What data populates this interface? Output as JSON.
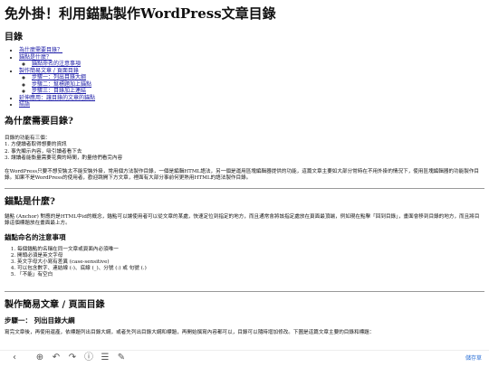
{
  "title": "免外掛！利用錨點製作WordPress文章目錄",
  "toc": {
    "heading": "目錄",
    "items": [
      {
        "label": "為什麼需要目錄？"
      },
      {
        "label": "錨點是什麼？"
      },
      {
        "label": "錨點命名的注意事項"
      },
      {
        "label": "製作簡易文章 / 頁面目錄"
      },
      {
        "label": "步驟一：列出目錄大綱"
      },
      {
        "label": "步驟二：幫標題加上錨點"
      },
      {
        "label": "步驟三：目錄加上連結"
      },
      {
        "label": "延伸應用：讓目錄的文章的錨點"
      },
      {
        "label": "結語"
      }
    ]
  },
  "sections": {
    "why": {
      "heading": "為什麼需要目錄?",
      "intro": "目錄的功能有三個：",
      "lines": [
        "1. 方便讀者取得想要的資訊",
        "2. 事先顯示內容，吸引讀者看下去",
        "3. 讓讀者能衡量需要花費的時間，酌量他們看完內容"
      ],
      "paragraph": "在WordPress只要不想安裝太不能安裝外掛，常用個方法製作目錄，一個是編輯HTML語法，另一個是運用區塊編輯器提供的功能，這篇文章主要如大部分常時在不用外掛的情況下，使用區塊編輯器的功能製作目錄。如果不是WordPress的使用者，歡迎跳開下方文章，裡面有大部分事前何更熟用HTML的語法製作目錄。"
    },
    "anchor": {
      "heading": "錨點是什麼?",
      "paragraph": "錨點 (Anchor) 對應的是HTML中id的概念，錨點可以讓使用者可以從文章的某處，快速定位到指定的地方，而且通常會將該指定處放在頁面最頂端，例如現在點擊「回到目錄」，畫面會移到目錄的地方，而且將目錄這個標題放在畫面最上方。",
      "sub_heading": "錨點命名的注意事項",
      "rules": [
        "每個錨點的名稱在同一文章或頁面內必須唯一",
        "開頭必須是英文字母",
        "英文字母大小寫有差異 (case-sensitive)",
        "可以包含數字、連結線 (-)、底線 (_)、分號 (:) 或 句號 (.)",
        "「不能」有空白"
      ]
    },
    "make": {
      "heading": "製作簡易文章 / 頁面目錄",
      "step1_heading": "步驟一： 列出目錄大綱",
      "step1_paragraph": "寫完文章後，再使用還產，依標題列出目錄大綱，或者先列出目錄大綱和標題，再開始撰寫內容都可以，目錄可以隨時增加修改。下圖是這篇文章主要的目錄和標題："
    }
  },
  "toolbar": {
    "save_label": "儲存草",
    "icons": [
      "chevron-left",
      "add",
      "undo",
      "redo",
      "info",
      "list-view",
      "edit"
    ]
  }
}
